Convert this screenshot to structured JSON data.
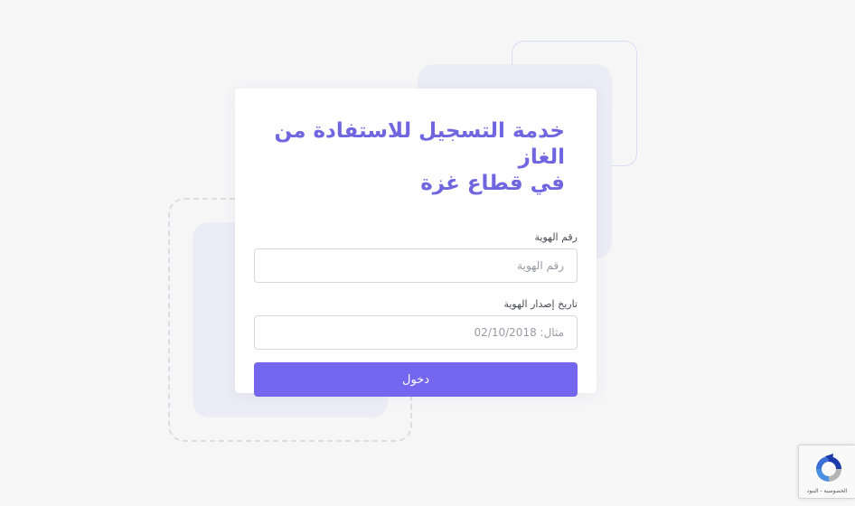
{
  "form": {
    "title_line1": "خدمة التسجيل للاستفادة من الغاز",
    "title_line2": "في قطاع غزة",
    "id_label": "رقم الهوية",
    "id_placeholder": "رقم الهوية",
    "id_value": "",
    "date_label": "تاريخ إصدار الهوية",
    "date_placeholder": "مثال: 02/10/2018",
    "date_value": "",
    "submit_label": "دخول"
  },
  "recaptcha": {
    "links_text": "الخصوصية - البنود",
    "icon": "recaptcha-icon"
  },
  "colors": {
    "accent": "#7367f0",
    "title": "#7066e0",
    "background": "#f6f6f7",
    "decor": "#ececf6"
  }
}
